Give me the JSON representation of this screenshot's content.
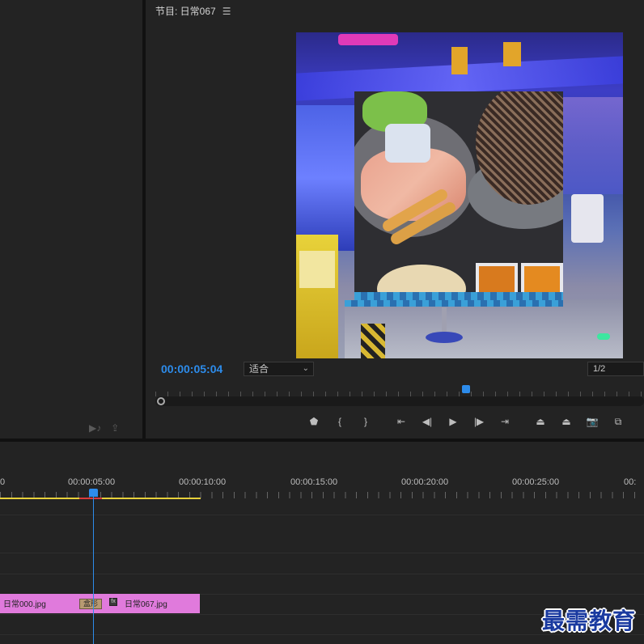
{
  "program_monitor": {
    "title": "节目: 日常067",
    "menu_icon": "hamburger-icon",
    "timecode": "00:00:05:04",
    "fit_select": "适合",
    "resolution_select": "1/2"
  },
  "transport_controls": [
    {
      "name": "marker-icon",
      "glyph": "⬟"
    },
    {
      "name": "mark-in-icon",
      "glyph": "{"
    },
    {
      "name": "mark-out-icon",
      "glyph": "}"
    },
    {
      "name": "go-to-in-icon",
      "glyph": "⇤"
    },
    {
      "name": "step-back-icon",
      "glyph": "◀|"
    },
    {
      "name": "play-icon",
      "glyph": "▶"
    },
    {
      "name": "step-forward-icon",
      "glyph": "|▶"
    },
    {
      "name": "go-to-out-icon",
      "glyph": "⇥"
    },
    {
      "name": "lift-icon",
      "glyph": "⏏"
    },
    {
      "name": "extract-icon",
      "glyph": "⏏"
    },
    {
      "name": "export-frame-icon",
      "glyph": "📷"
    },
    {
      "name": "compare-view-icon",
      "glyph": "⧉"
    }
  ],
  "left_panel": {
    "icons": [
      "insert-icon",
      "overwrite-icon"
    ]
  },
  "timeline": {
    "ruler_labels": [
      "0",
      "00:00:05:00",
      "00:00:10:00",
      "00:00:15:00",
      "00:00:20:00",
      "00:00:25:00",
      "00:"
    ],
    "clips": [
      {
        "label": "日常000.jpg"
      },
      {
        "label": "日常067.jpg",
        "fx": "fx"
      }
    ],
    "transition_label": "盒形"
  },
  "watermark": "最需教育",
  "colors": {
    "accent": "#2d8ceb",
    "clip": "#e07adc",
    "work_area": "#e6d03a"
  }
}
